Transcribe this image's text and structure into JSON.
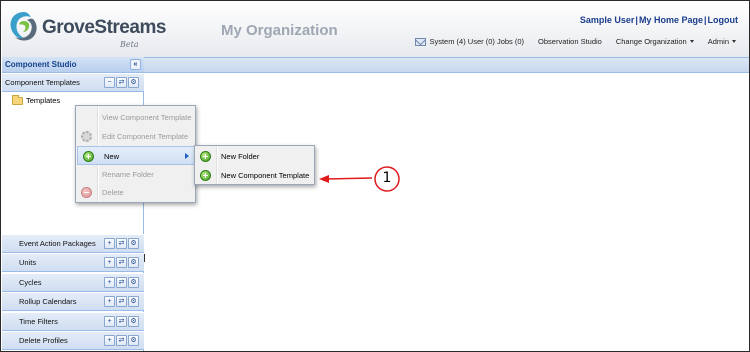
{
  "header": {
    "brand": "GroveStreams",
    "beta": "Beta",
    "org_title": "My Organization",
    "user_links": [
      "Sample User",
      "My Home Page",
      "Logout"
    ],
    "nav": {
      "messages": "System (4) User (0) Jobs (0)",
      "observation_studio": "Observation Studio",
      "change_org": "Change Organization",
      "admin": "Admin"
    }
  },
  "left_panel": {
    "title": "Component Studio",
    "collapse_icon": "double-chevron-left-icon",
    "component_templates": "Component Templates",
    "tree_folder": "Templates",
    "sections": [
      "Event Action Packages",
      "Units",
      "Cycles",
      "Rollup Calendars",
      "Time Filters",
      "Delete Profiles"
    ]
  },
  "context_menu": {
    "items": [
      "View Component Template",
      "Edit Component Template",
      "New",
      "Rename Folder",
      "Delete"
    ],
    "submenu": [
      "New Folder",
      "New Component Template"
    ]
  },
  "annotation": {
    "label": "1",
    "color": "#e01a1a"
  },
  "colors": {
    "accent": "#15428b",
    "link": "#1a3d8c",
    "panel_border": "#99bbe8"
  }
}
